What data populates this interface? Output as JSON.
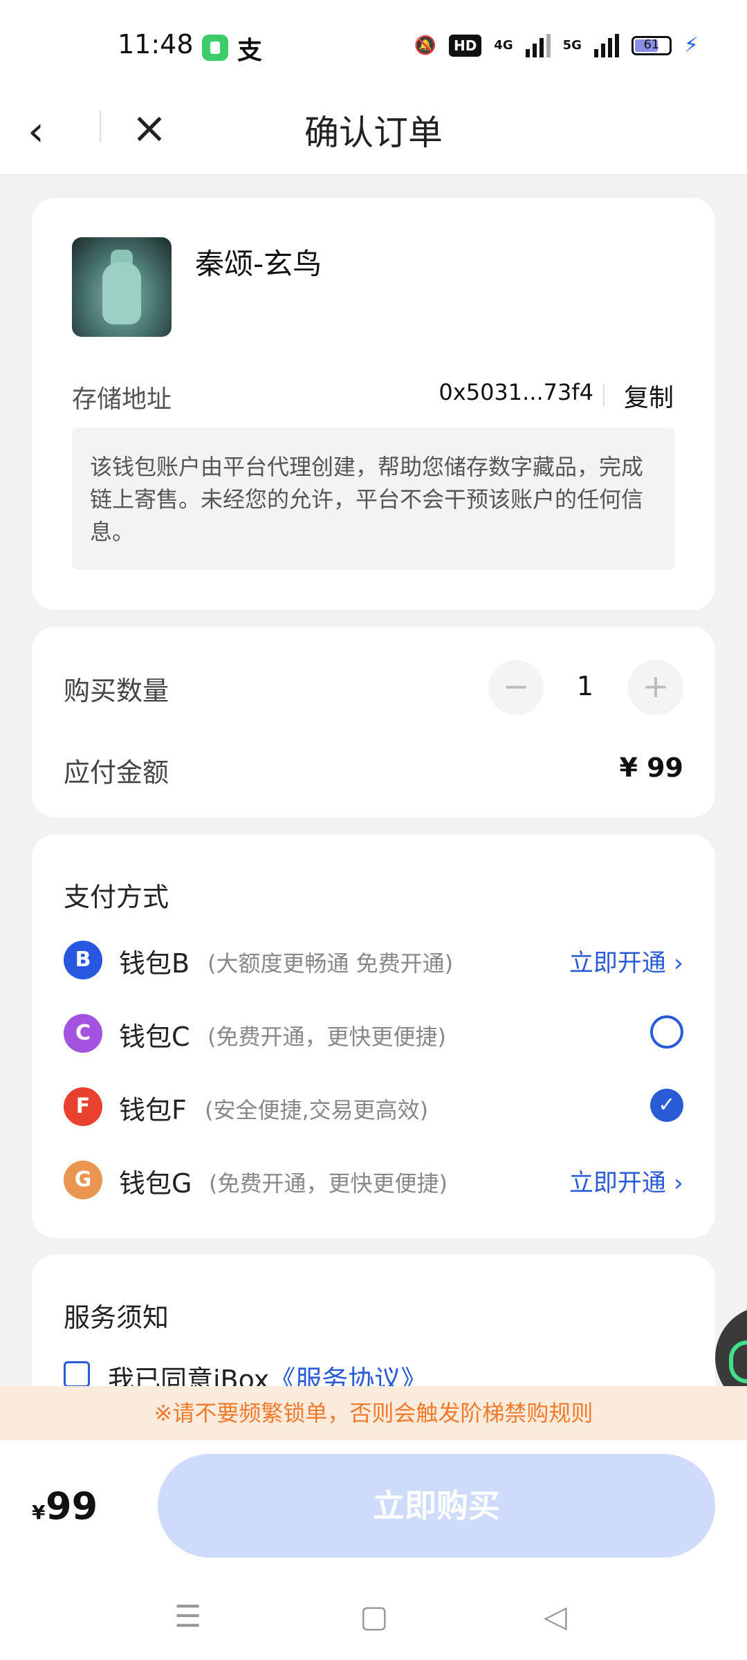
{
  "status_bar": {
    "time": "11:48",
    "alipay_glyph": "支",
    "hd_label": "HD",
    "net1": "4G",
    "net2": "5G",
    "battery": "61"
  },
  "nav": {
    "title": "确认订单"
  },
  "product": {
    "name": "秦颂-玄鸟",
    "address_label": "存储地址",
    "address_value": "0x5031...73f4",
    "copy_label": "复制",
    "notice": "该钱包账户由平台代理创建，帮助您储存数字藏品，完成链上寄售。未经您的允许，平台不会干预该账户的任何信息。"
  },
  "order": {
    "quantity_label": "购买数量",
    "quantity": "1",
    "minus": "−",
    "plus": "+",
    "amount_label": "应付金额",
    "amount": "¥ 99"
  },
  "payment": {
    "title": "支付方式",
    "methods": [
      {
        "icon": "B",
        "name": "钱包B",
        "desc": "(大额度更畅通 免费开通)",
        "action": "立即开通 ›",
        "color": "#2857e0"
      },
      {
        "icon": "C",
        "name": "钱包C",
        "desc": "(免费开通，更快更便捷)",
        "action": "",
        "color": "#a452e0"
      },
      {
        "icon": "F",
        "name": "钱包F",
        "desc": "(安全便捷,交易更高效)",
        "action": "✓",
        "color": "#e8412f"
      },
      {
        "icon": "G",
        "name": "钱包G",
        "desc": "(免费开通，更快更便捷)",
        "action": "立即开通 ›",
        "color": "#ea9650"
      }
    ]
  },
  "service": {
    "title": "服务须知",
    "agree_text": "我已同意iBox",
    "agree_link": "《服务协议》"
  },
  "warning": "※请不要频繁锁单，否则会触发阶梯禁购规则",
  "footer": {
    "currency": "¥",
    "total": "99",
    "buy_label": "立即购买"
  },
  "sys_nav": {
    "menu": "☰",
    "home": "▢",
    "back": "◁"
  }
}
